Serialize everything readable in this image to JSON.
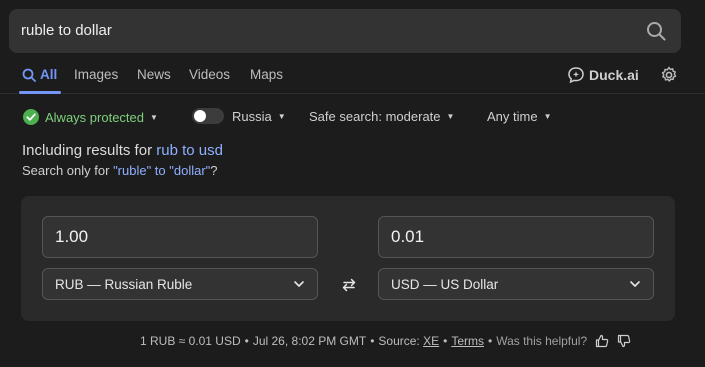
{
  "search": {
    "query": "ruble to dollar"
  },
  "tabs": [
    {
      "label": "All",
      "active": true
    },
    {
      "label": "Images"
    },
    {
      "label": "News"
    },
    {
      "label": "Videos"
    },
    {
      "label": "Maps"
    }
  ],
  "duck_ai": {
    "label": "Duck.ai"
  },
  "filters": {
    "protected": "Always protected",
    "region": "Russia",
    "safe_search": "Safe search: moderate",
    "time": "Any time"
  },
  "correction": {
    "prefix": "Including results for",
    "from_term": "rub",
    "connector": "to",
    "to_term": "usd",
    "only_prefix": "Search only for",
    "only_query": "\"ruble\" to \"dollar\"",
    "only_suffix": "?"
  },
  "converter": {
    "from_amount": "1.00",
    "to_amount": "0.01",
    "from_currency": "RUB — Russian Ruble",
    "to_currency": "USD — US Dollar"
  },
  "footer": {
    "rate": "1 RUB ≈ 0.01 USD",
    "date": "Jul 26, 8:02 PM GMT",
    "source_prefix": "Source:",
    "source": "XE",
    "terms": "Terms",
    "helpful": "Was this helpful?"
  },
  "colors": {
    "accent": "#7295f6",
    "protected": "#7ed07e",
    "background": "#1c1c1c"
  }
}
